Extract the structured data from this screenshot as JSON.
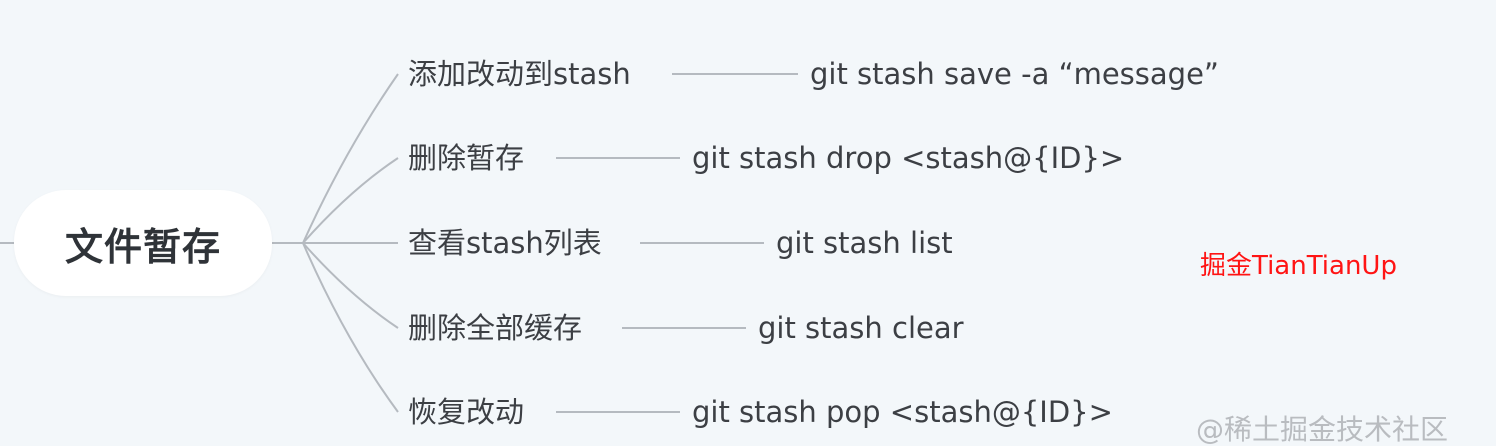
{
  "root": {
    "label": "文件暂存"
  },
  "branches": [
    {
      "label": "添加改动到stash",
      "command": "git stash save -a “message”"
    },
    {
      "label": "删除暂存",
      "command": "git stash drop <stash@{ID}>"
    },
    {
      "label": "查看stash列表",
      "command": "git stash list"
    },
    {
      "label": "删除全部缓存",
      "command": "git stash clear"
    },
    {
      "label": "恢复改动",
      "command": "git stash pop <stash@{ID}>"
    }
  ],
  "watermarks": {
    "red": "掘金TianTianUp",
    "bottom": "@稀土掘金技术社区"
  },
  "colors": {
    "background": "#f3f7fa",
    "connector": "#b5bac0",
    "text": "#3c3f44",
    "root_text": "#2f3338",
    "watermark_red": "#ff1414"
  }
}
